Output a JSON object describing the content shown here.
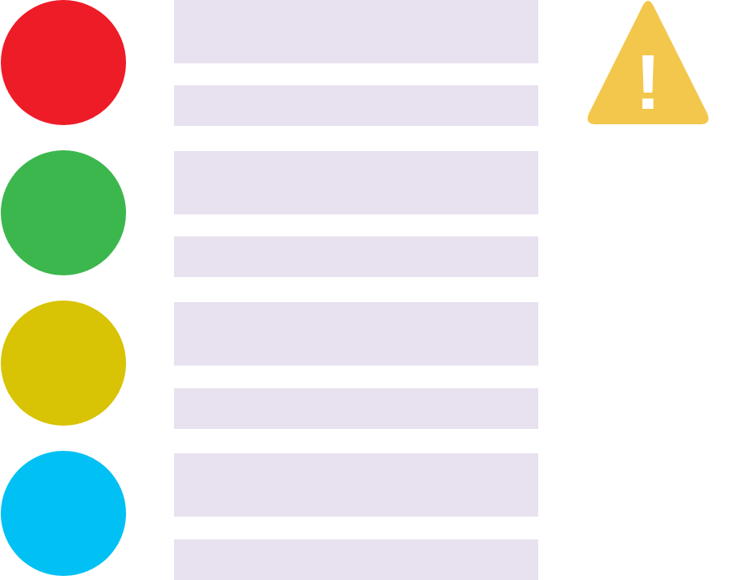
{
  "colors": {
    "red": "#ee1c27",
    "green": "#3cb74d",
    "yellow": "#d8c304",
    "blue": "#01c0f4",
    "placeholder_bar": "#e8e1ef",
    "warning": "#f3c74c",
    "warning_mark": "#ffffff"
  },
  "items": [
    {
      "status": "red",
      "icon": "red-circle"
    },
    {
      "status": "green",
      "icon": "green-circle"
    },
    {
      "status": "yellow",
      "icon": "yellow-circle"
    },
    {
      "status": "blue",
      "icon": "blue-circle"
    }
  ],
  "alert": {
    "icon": "warning-triangle-icon",
    "mark": "!"
  }
}
